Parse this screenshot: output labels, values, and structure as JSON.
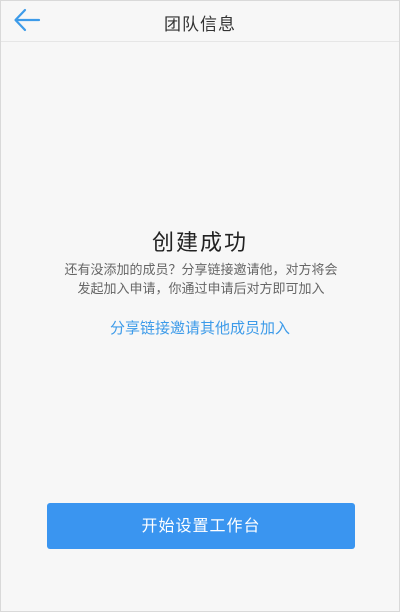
{
  "header": {
    "title": "团队信息",
    "back_icon": "arrow-left-icon",
    "accent_color": "#3d9be9"
  },
  "main": {
    "success_title": "创建成功",
    "description_line1": "还有没添加的成员？分享链接邀请他，对方将会",
    "description_line2": "发起加入申请，你通过申请后对方即可加入",
    "share_link_label": "分享链接邀请其他成员加入",
    "link_color": "#3d9be9"
  },
  "footer": {
    "primary_button_label": "开始设置工作台",
    "button_color": "#3a95f0"
  }
}
